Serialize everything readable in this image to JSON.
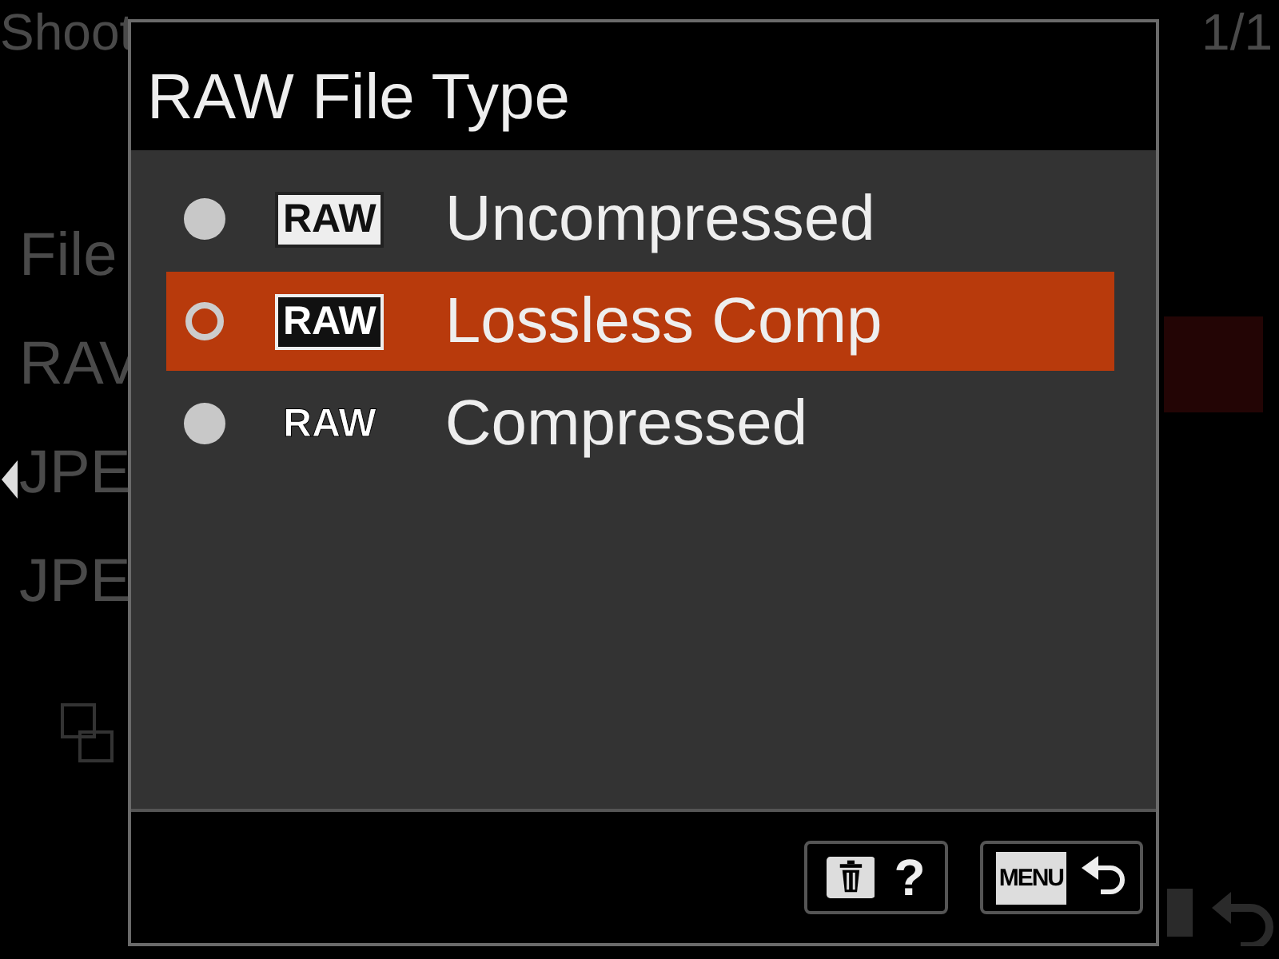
{
  "background_menu": {
    "title": "Shoot",
    "page": "1/1",
    "items": [
      "File",
      "RAV",
      "JPE",
      "JPE"
    ]
  },
  "dialog": {
    "title": "RAW File Type",
    "options": [
      {
        "badge": "RAW",
        "kind": "boxed",
        "label": "Uncompressed",
        "selected": false
      },
      {
        "badge": "RAW",
        "kind": "boxed",
        "label": "Lossless Comp",
        "selected": true
      },
      {
        "badge": "RAW",
        "kind": "plain",
        "label": "Compressed",
        "selected": false
      }
    ],
    "footer": [
      {
        "kind": "delete-help",
        "symbol": "?"
      },
      {
        "kind": "menu-back",
        "key": "MENU"
      }
    ]
  }
}
